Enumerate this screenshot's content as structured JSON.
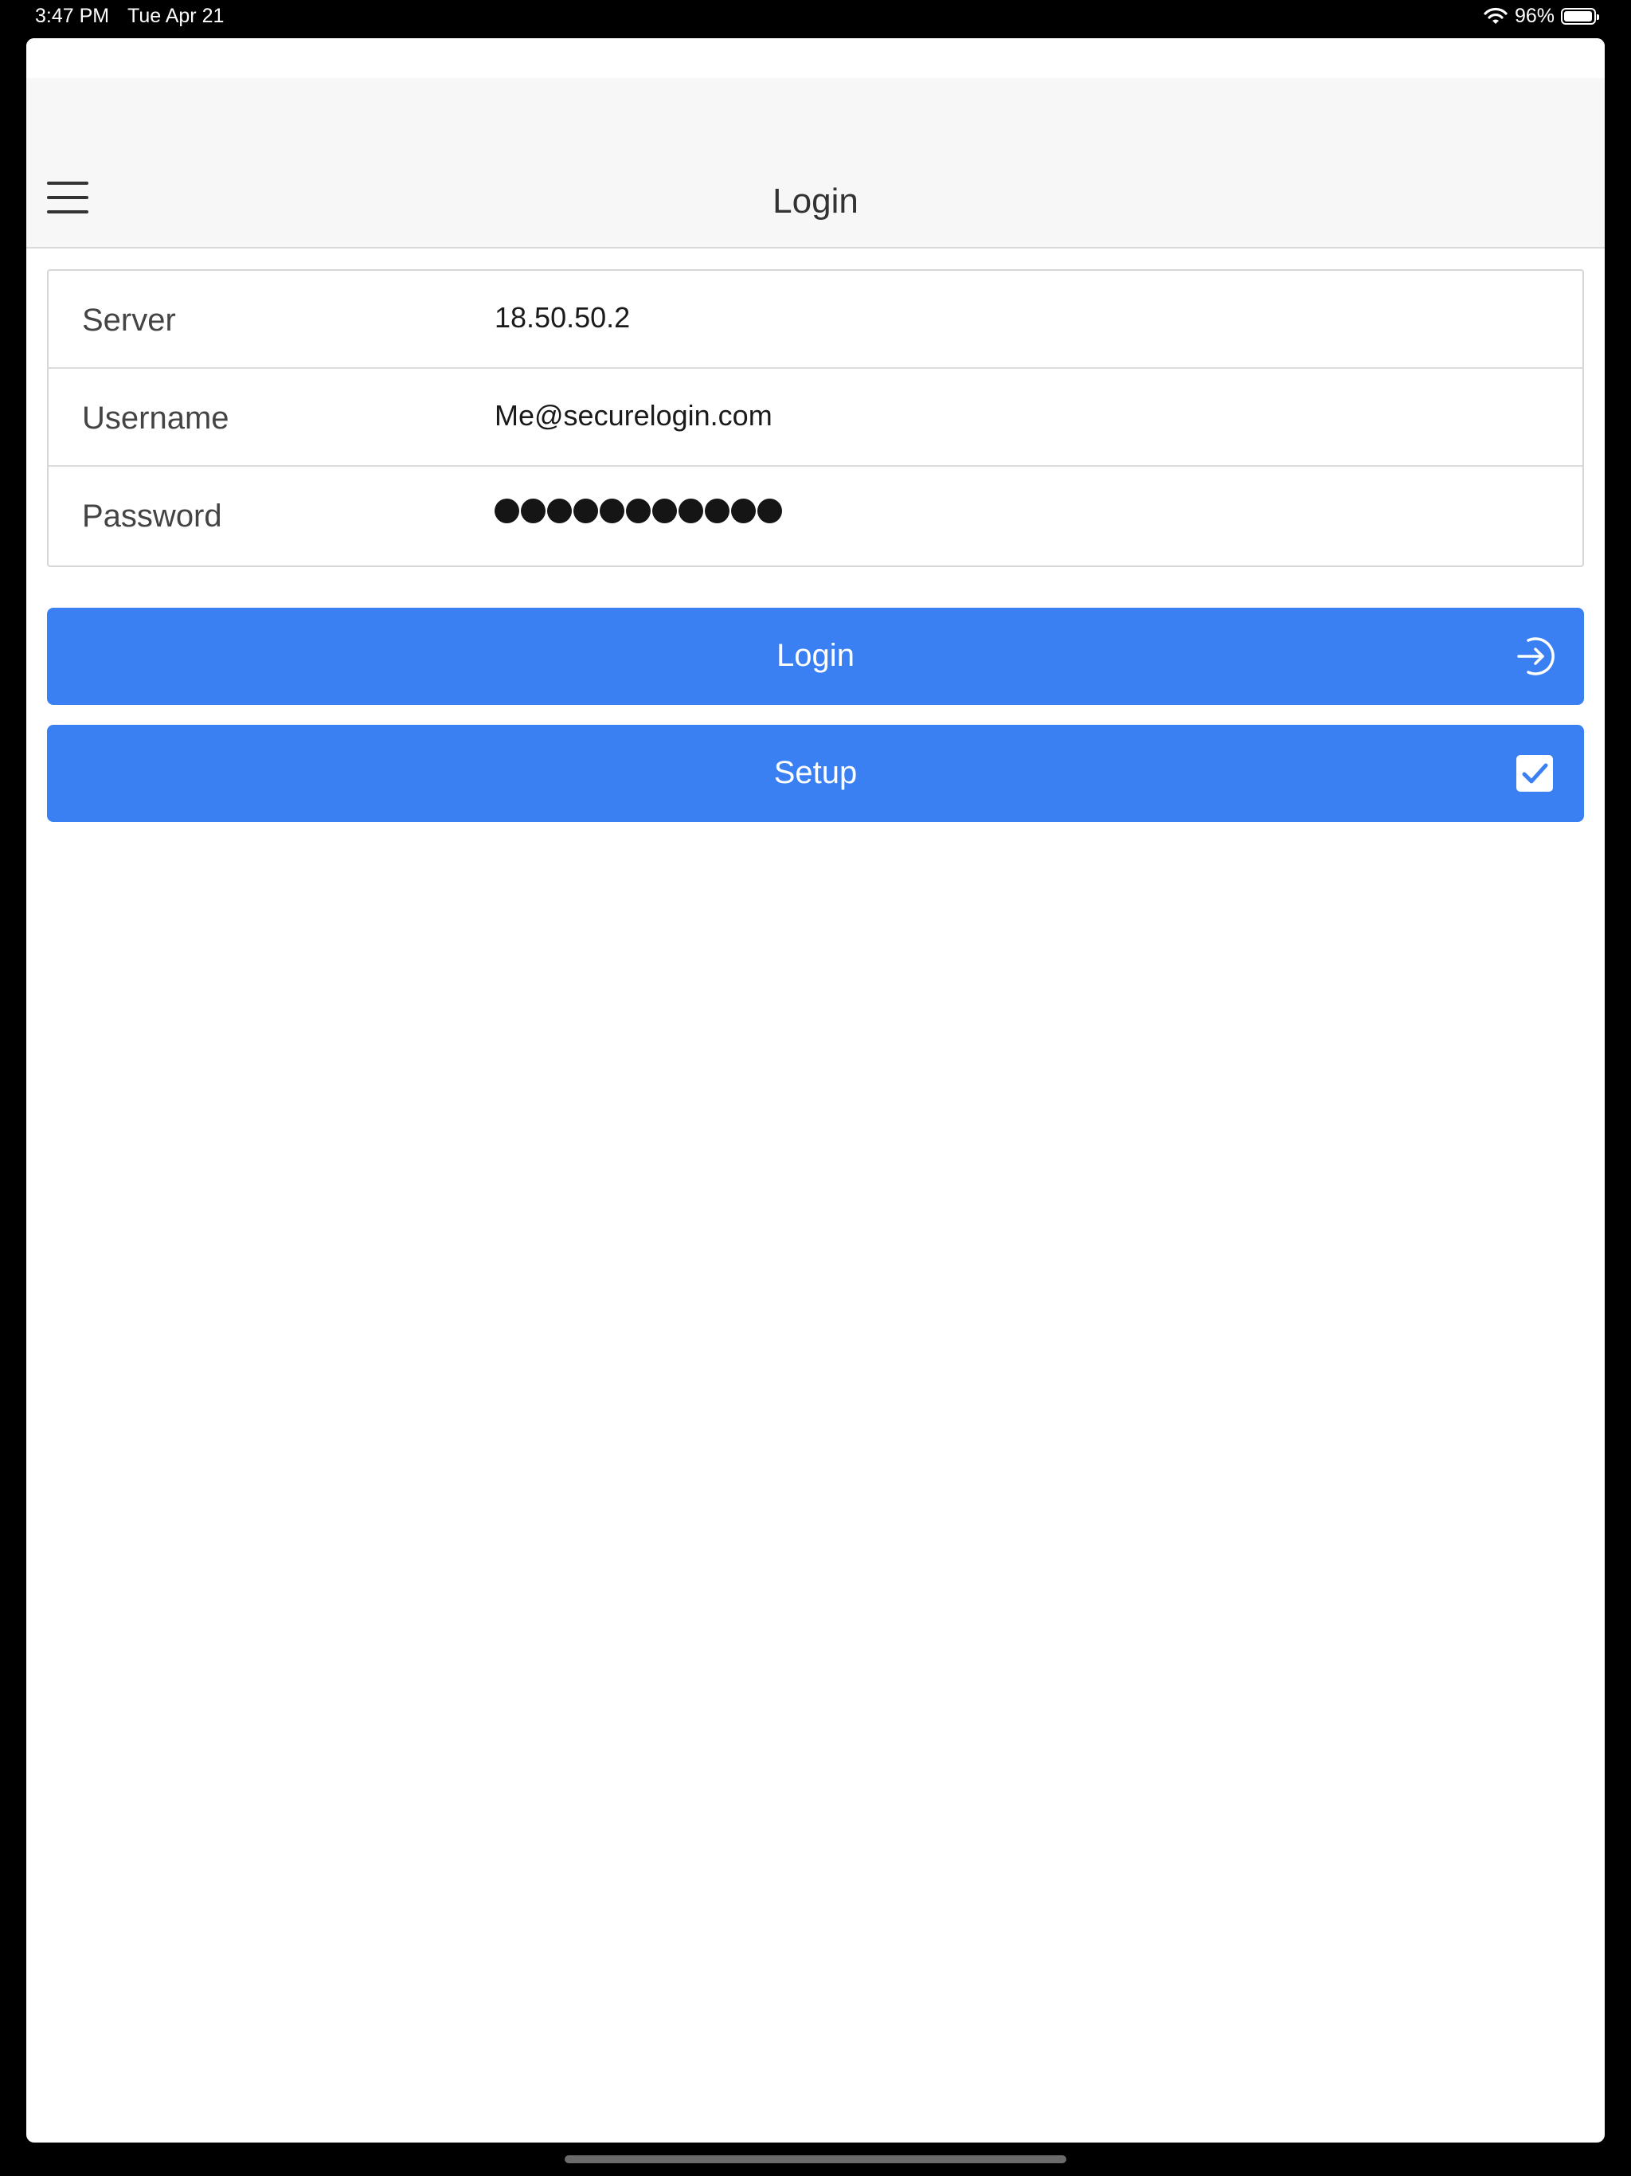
{
  "status_bar": {
    "time": "3:47 PM",
    "date": "Tue Apr 21",
    "battery_text": "96%",
    "battery_level": 0.96,
    "wifi_icon": "wifi-icon",
    "battery_icon": "battery-icon"
  },
  "nav": {
    "title": "Login",
    "menu_icon": "hamburger-menu-icon"
  },
  "form": {
    "server": {
      "label": "Server",
      "value": "18.50.50.2"
    },
    "username": {
      "label": "Username",
      "value": "Me@securelogin.com"
    },
    "password": {
      "label": "Password",
      "masked_length": 11
    }
  },
  "buttons": {
    "login": {
      "label": "Login",
      "icon": "sign-in-arrow-icon"
    },
    "setup": {
      "label": "Setup",
      "icon": "checkbox-checked-icon"
    }
  },
  "colors": {
    "accent": "#3a80f2",
    "nav_background": "#f7f7f7",
    "text": "#333333"
  }
}
